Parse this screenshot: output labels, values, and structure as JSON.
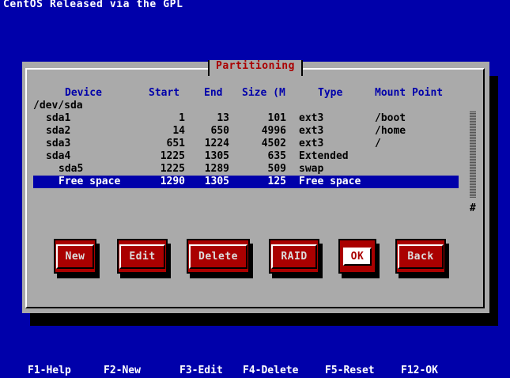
{
  "top_message": "CentOS Released via the GPL",
  "dialog": {
    "title": "Partitioning"
  },
  "columns": {
    "device": "Device",
    "start": "Start",
    "end": "End",
    "size": "Size (M",
    "type": "Type",
    "mount": "Mount Point"
  },
  "rows": [
    {
      "device": "/dev/sda",
      "start": "",
      "end": "",
      "size": "",
      "type": "",
      "mount": "",
      "indent": 0,
      "selected": false
    },
    {
      "device": "sda1",
      "start": "1",
      "end": "13",
      "size": "101",
      "type": "ext3",
      "mount": "/boot",
      "indent": 1,
      "selected": false
    },
    {
      "device": "sda2",
      "start": "14",
      "end": "650",
      "size": "4996",
      "type": "ext3",
      "mount": "/home",
      "indent": 1,
      "selected": false
    },
    {
      "device": "sda3",
      "start": "651",
      "end": "1224",
      "size": "4502",
      "type": "ext3",
      "mount": "/",
      "indent": 1,
      "selected": false
    },
    {
      "device": "sda4",
      "start": "1225",
      "end": "1305",
      "size": "635",
      "type": "Extended",
      "mount": "",
      "indent": 1,
      "selected": false
    },
    {
      "device": "sda5",
      "start": "1225",
      "end": "1289",
      "size": "509",
      "type": "swap",
      "mount": "",
      "indent": 2,
      "selected": false
    },
    {
      "device": "Free space",
      "start": "1290",
      "end": "1305",
      "size": "125",
      "type": "Free space",
      "mount": "",
      "indent": 2,
      "selected": true
    }
  ],
  "scroll_marker": "#",
  "buttons": {
    "new": "New",
    "edit": "Edit",
    "delete": "Delete",
    "raid": "RAID",
    "ok": "OK",
    "back": "Back"
  },
  "footer": {
    "f1": "F1-Help",
    "f2": "F2-New",
    "f3": "F3-Edit",
    "f4": "F4-Delete",
    "f5": "F5-Reset",
    "f12": "F12-OK"
  },
  "colors": {
    "background": "#0000aa",
    "dialog": "#aaaaaa",
    "button": "#aa0000",
    "selection": "#0000aa"
  }
}
